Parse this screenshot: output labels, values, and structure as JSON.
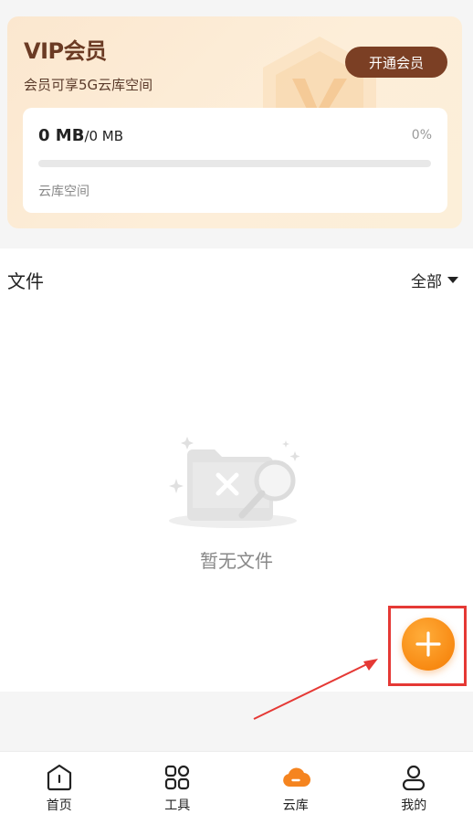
{
  "vip": {
    "title": "VIP会员",
    "subtitle": "会员可享5G云库空间",
    "button": "开通会员"
  },
  "storage": {
    "used": "0 MB",
    "total": "/0 MB",
    "percent": "0%",
    "percent_value": 0,
    "label": "云库空间",
    "accent": "#f29a2e"
  },
  "files": {
    "title": "文件",
    "filter": "全部",
    "empty_text": "暂无文件"
  },
  "fab": {
    "icon": "plus-icon",
    "color": "#f88a13"
  },
  "tabs": [
    {
      "label": "首页",
      "icon": "home-icon"
    },
    {
      "label": "工具",
      "icon": "grid-icon"
    },
    {
      "label": "云库",
      "icon": "cloud-icon",
      "active": true
    },
    {
      "label": "我的",
      "icon": "user-icon"
    }
  ]
}
